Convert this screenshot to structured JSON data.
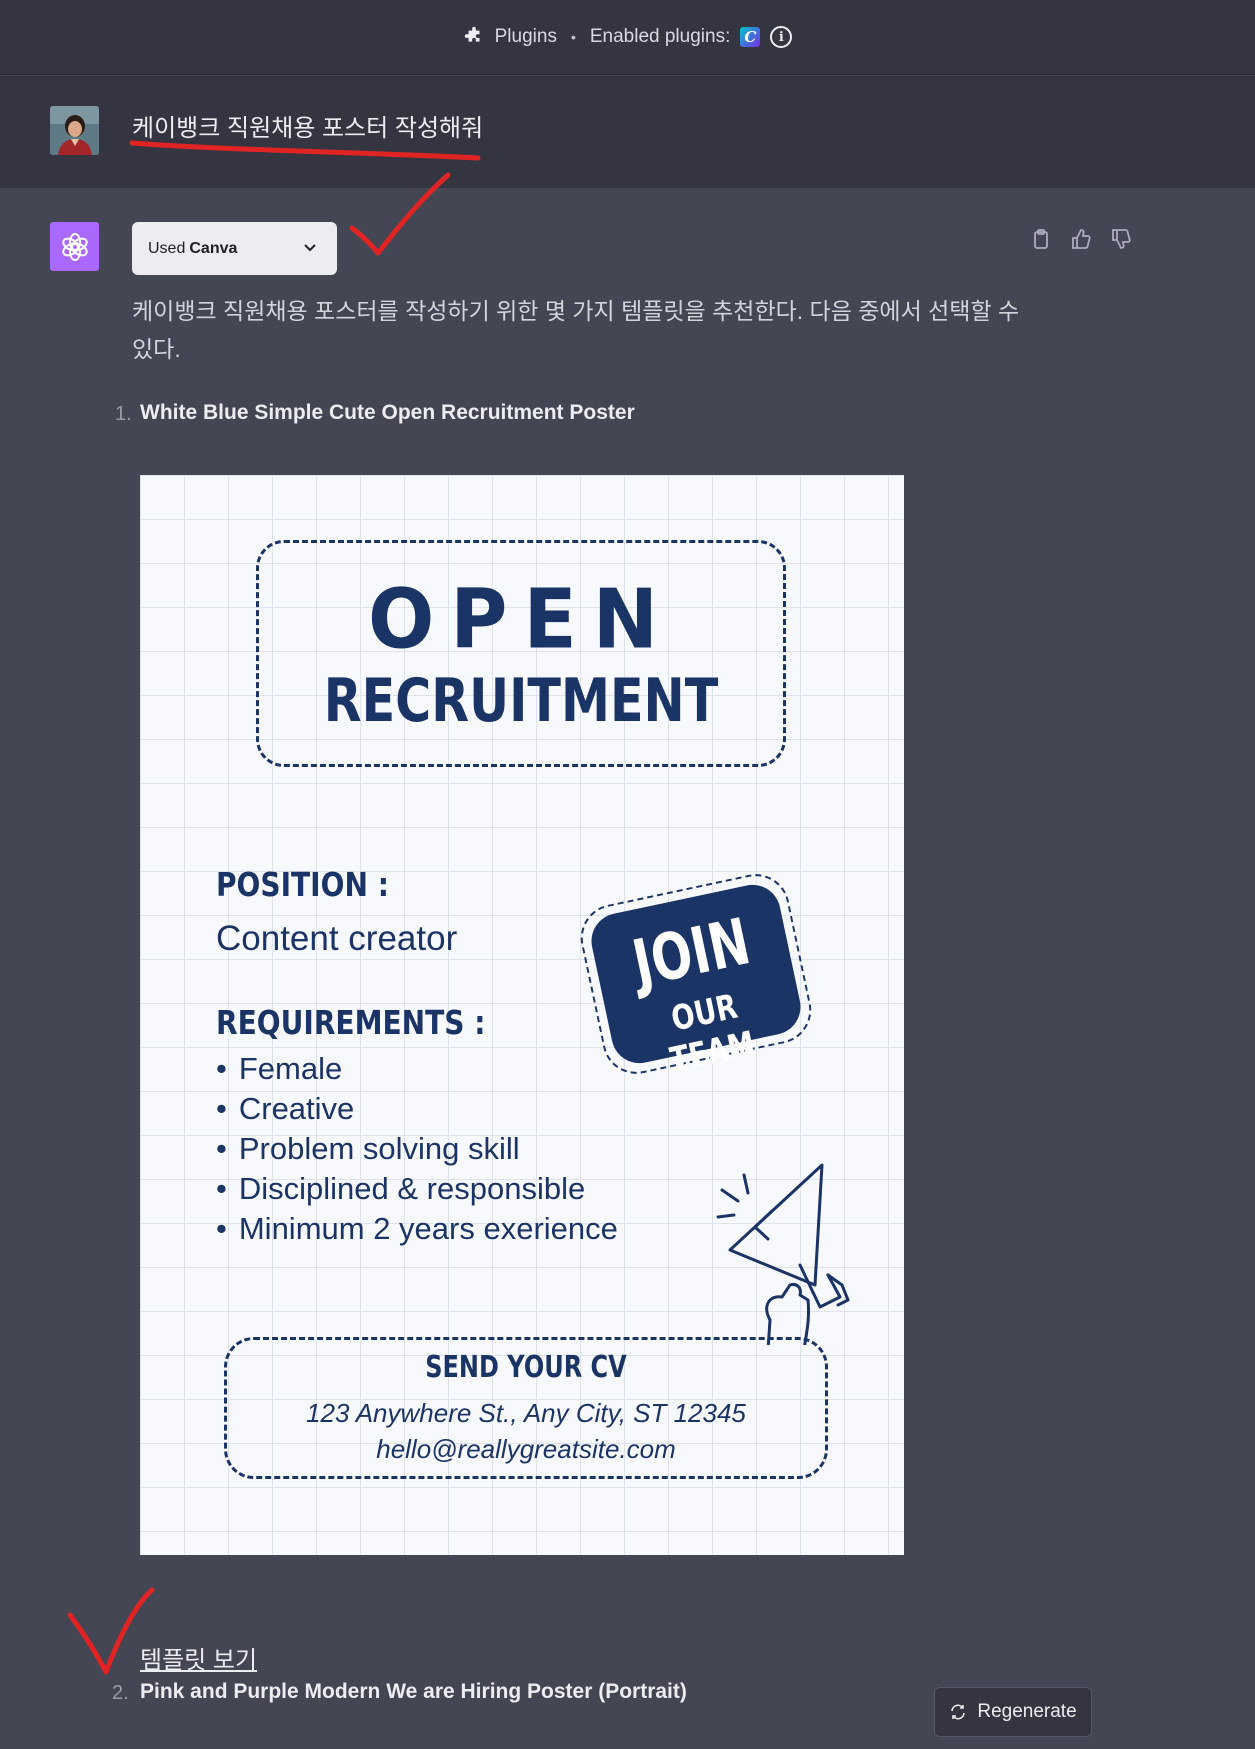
{
  "topbar": {
    "plugins_label": "Plugins",
    "separator": "•",
    "enabled_label": "Enabled plugins:",
    "plugin_badge": "C",
    "info_glyph": "i"
  },
  "user": {
    "message": "케이뱅크 직원채용 포스터 작성해줘"
  },
  "assistant": {
    "used_prefix": "Used",
    "used_plugin": "Canva",
    "intro": "케이뱅크 직원채용 포스터를 작성하기 위한 몇 가지 템플릿을 추천한다. 다음 중에서 선택할 수 있다.",
    "items": [
      {
        "num": "1.",
        "title": "White Blue Simple Cute Open Recruitment Poster"
      },
      {
        "num": "2.",
        "title": "Pink and Purple Modern We are Hiring Poster (Portrait)"
      }
    ],
    "template_link": "템플릿 보기"
  },
  "poster": {
    "open": "OPEN",
    "recruitment": "RECRUITMENT",
    "position_label": "POSITION :",
    "position_value": "Content creator",
    "requirements_label": "REQUIREMENTS :",
    "requirements": [
      "Female",
      "Creative",
      "Problem solving skill",
      "Disciplined & responsible",
      "Minimum 2 years exerience"
    ],
    "join": "JOIN",
    "our_team": "OUR TEAM",
    "send_cv": "SEND YOUR CV",
    "address": "123 Anywhere St., Any City, ST 12345",
    "email": "hello@reallygreatsite.com"
  },
  "regenerate_label": "Regenerate",
  "colors": {
    "page_bg": "#444654",
    "user_bg": "#343541",
    "poster_navy": "#1b3466",
    "annotation_red": "#e02424",
    "gpt_logo_bg": "#ab68ff"
  },
  "icons": [
    "puzzle-icon",
    "canva-icon",
    "info-icon",
    "chevron-down-icon",
    "clipboard-icon",
    "thumbs-up-icon",
    "thumbs-down-icon",
    "openai-logo-icon",
    "megaphone-icon",
    "refresh-icon"
  ]
}
